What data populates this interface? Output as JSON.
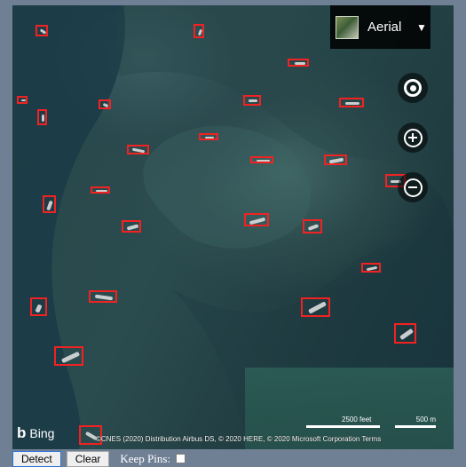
{
  "map": {
    "view_type": "Aerial",
    "logo": "Bing",
    "copyright": "©CNES (2020) Distribution Airbus DS, © 2020 HERE, © 2020 Microsoft Corporation Terms",
    "scale": {
      "left_label": "2500 feet",
      "right_label": "500 m"
    },
    "controls": [
      {
        "name": "locate-me-button",
        "icon": "target-icon"
      },
      {
        "name": "zoom-in-button",
        "icon": "plus-icon"
      },
      {
        "name": "zoom-out-button",
        "icon": "minus-icon"
      }
    ]
  },
  "toolbar": {
    "detect_label": "Detect",
    "clear_label": "Clear",
    "keep_pins_label": "Keep Pins:"
  }
}
